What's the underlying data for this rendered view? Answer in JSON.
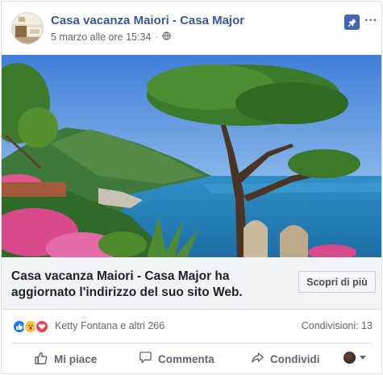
{
  "post": {
    "page_name": "Casa vacanza Maiori - Casa Major",
    "timestamp": "5 marzo alle ore 15:34",
    "separator": "·",
    "audience_icon": "globe-icon"
  },
  "header_icons": {
    "pin": "pin-icon",
    "more": "ellipsis-icon",
    "more_glyph": "···",
    "accent_color": "#4267b2"
  },
  "link_preview": {
    "title": "Casa vacanza Maiori - Casa Major ha aggiornato l'indirizzo del suo sito Web.",
    "cta_label": "Scopri di più"
  },
  "engagement": {
    "reactions": [
      "like",
      "wow",
      "love"
    ],
    "reactors_text": "Ketty Fontana e altri 266",
    "shares_text": "Condivisioni: 13"
  },
  "actions": {
    "like_label": "Mi piace",
    "comment_label": "Commenta",
    "share_label": "Condividi"
  }
}
